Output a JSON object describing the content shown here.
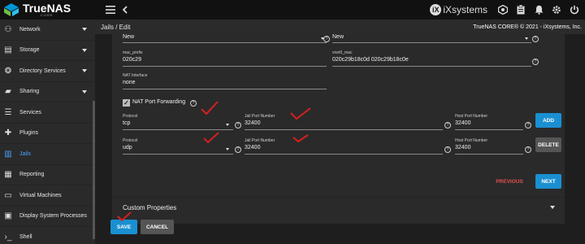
{
  "topbar": {
    "logo_name": "TrueNAS",
    "logo_sub": "CORE",
    "brand": "iXsystems",
    "icons": [
      "menu-icon",
      "back-icon",
      "truecommand-icon",
      "clipboard-icon",
      "bell-icon",
      "gear-icon",
      "power-icon"
    ]
  },
  "sidebar": {
    "items": [
      {
        "label": "Network",
        "icon": "network-icon",
        "has_caret": true
      },
      {
        "label": "Storage",
        "icon": "storage-icon",
        "has_caret": true
      },
      {
        "label": "Directory Services",
        "icon": "directory-icon",
        "has_caret": true
      },
      {
        "label": "Sharing",
        "icon": "sharing-icon",
        "has_caret": true
      },
      {
        "label": "Services",
        "icon": "services-icon",
        "has_caret": false
      },
      {
        "label": "Plugins",
        "icon": "plugins-icon",
        "has_caret": false
      },
      {
        "label": "Jails",
        "icon": "jails-icon",
        "has_caret": false,
        "active": true
      },
      {
        "label": "Reporting",
        "icon": "reporting-icon",
        "has_caret": false
      },
      {
        "label": "Virtual Machines",
        "icon": "vm-icon",
        "has_caret": false
      },
      {
        "label": "Display System Processes",
        "icon": "processes-icon",
        "has_caret": false
      },
      {
        "label": "Shell",
        "icon": "shell-icon",
        "has_caret": false
      }
    ]
  },
  "header": {
    "breadcrumb": "Jails  /  Edit",
    "copyright": "TrueNAS CORE® © 2021 - iXsystems, Inc."
  },
  "form": {
    "top_left_value": "New",
    "top_right_value": "New",
    "mac_prefix_label": "mac_prefix",
    "mac_prefix_value": "020c29",
    "vnet0_mac_label": "vnet0_mac",
    "vnet0_mac_value": "020c29b18c0d 020c29b18c0e",
    "nat_interface_label": "NAT Interface",
    "nat_interface_value": "none",
    "nat_port_forwarding_label": "NAT Port Forwarding",
    "nat_port_forwarding_checked": true,
    "rules": [
      {
        "protocol_label": "Protocol",
        "protocol_value": "tcp",
        "jail_port_label": "Jail Port Number",
        "jail_port_value": "32400",
        "host_port_label": "Host Port Number",
        "host_port_value": "32400",
        "action_label": "ADD"
      },
      {
        "protocol_label": "Protocol",
        "protocol_value": "udp",
        "jail_port_label": "Jail Port Number",
        "jail_port_value": "32400",
        "host_port_label": "Host Port Number",
        "host_port_value": "32400",
        "action_label": "DELETE"
      }
    ],
    "previous_label": "PREVIOUS",
    "next_label": "NEXT",
    "custom_properties_label": "Custom Properties",
    "save_label": "SAVE",
    "cancel_label": "CANCEL",
    "help_glyph": "?"
  },
  "colors": {
    "accent": "#1a8fd1",
    "active_nav": "#4aa3ff",
    "previous_text": "#e05050",
    "annotation_red": "#d62020"
  }
}
